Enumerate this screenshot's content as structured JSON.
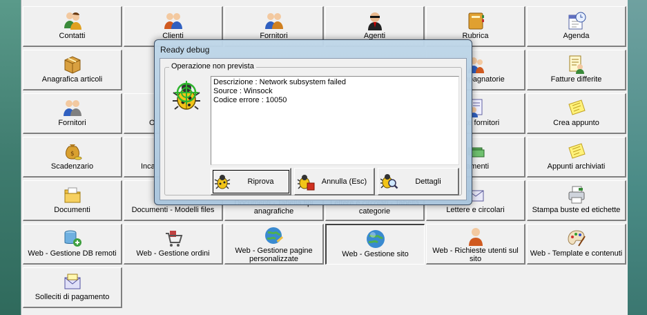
{
  "tiles": [
    {
      "label": "Contatti",
      "icon": "people-icon"
    },
    {
      "label": "Clienti",
      "icon": "people-icon"
    },
    {
      "label": "Fornitori",
      "icon": "people-icon"
    },
    {
      "label": "Agenti",
      "icon": "agent-icon"
    },
    {
      "label": "Rubrica",
      "icon": "address-book-icon"
    },
    {
      "label": "Agenda",
      "icon": "calendar-icon"
    },
    {
      "label": "Anagrafica articoli",
      "icon": "box-icon"
    },
    {
      "label": "accompagnatorie",
      "icon": "people-icon"
    },
    {
      "label": "Fatture differite",
      "icon": "invoice-people-icon"
    },
    {
      "label": "Fornitori",
      "icon": "people-icon"
    },
    {
      "label": "O",
      "icon": ""
    },
    {
      "label": "ifferite fornitori",
      "icon": "invoice-people-icon"
    },
    {
      "label": "Crea appunto",
      "icon": "note-icon"
    },
    {
      "label": "Scadenzario",
      "icon": "money-bag-icon"
    },
    {
      "label": "Inca",
      "icon": ""
    },
    {
      "label": "gamenti",
      "icon": "money-icon"
    },
    {
      "label": "Appunti archiviati",
      "icon": "note-icon"
    },
    {
      "label": "Documenti",
      "icon": "folder-icon"
    },
    {
      "label": "Documenti - Modelli files",
      "icon": ""
    },
    {
      "label": "Documenti - Tabella tipi anagrafiche",
      "icon": ""
    },
    {
      "label": "Lettere e circolari - Tabella categorie",
      "icon": ""
    },
    {
      "label": "Lettere e circolari",
      "icon": "letter-icon"
    },
    {
      "label": "Stampa buste ed etichette",
      "icon": "printer-icon"
    },
    {
      "label": "Web - Gestione DB remoti",
      "icon": "database-icon"
    },
    {
      "label": "Web - Gestione ordini",
      "icon": "cart-icon"
    },
    {
      "label": "Web - Gestione pagine personalizzate",
      "icon": "globe-edit-icon"
    },
    {
      "label": "Web - Gestione sito",
      "icon": "globe-icon"
    },
    {
      "label": "Web - Richieste utenti sul sito",
      "icon": "user-icon"
    },
    {
      "label": "Web - Template e contenuti",
      "icon": "palette-icon"
    },
    {
      "label": "Solleciti di pagamento",
      "icon": "mail-icon"
    }
  ],
  "dialog": {
    "title": "Ready debug",
    "group_label": "Operazione non prevista",
    "message_lines": [
      "Descrizione : Network subsystem failed",
      "Source : Winsock",
      "Codice errore : 10050"
    ],
    "buttons": {
      "retry": "Riprova",
      "cancel": "Annulla (Esc)",
      "details": "Dettagli"
    }
  },
  "colors": {
    "window_bg": "#f0f0f0",
    "dialog_frame": "#b5cfe4",
    "bug_green": "#2fb52f",
    "bug_yellow": "#f2c418"
  }
}
